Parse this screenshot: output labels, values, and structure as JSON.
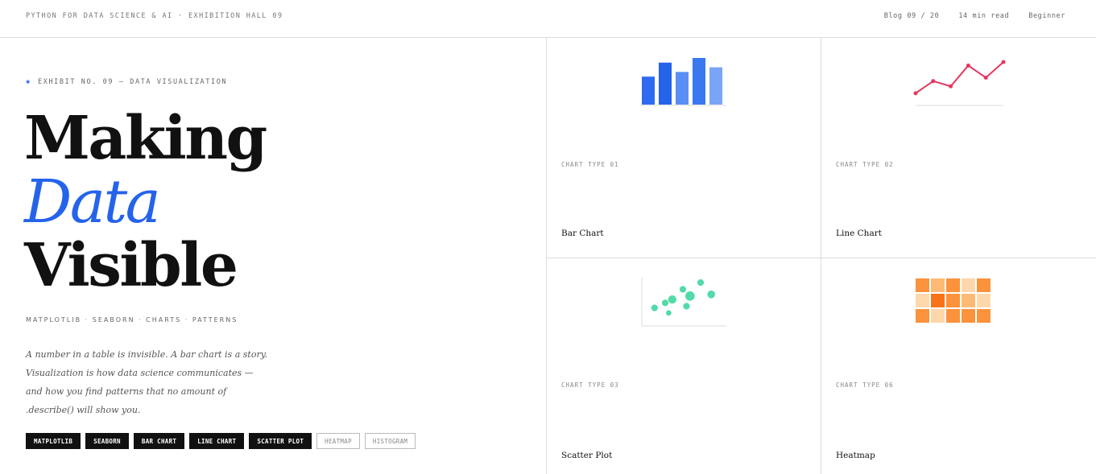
{
  "header": {
    "crumb": "PYTHON FOR DATA SCIENCE & AI · EXHIBITION HALL 09",
    "blog": "Blog 09 / 20",
    "read_time": "14 min read",
    "level": "Beginner"
  },
  "hero": {
    "eyebrow": "EXHIBIT NO. 09 — DATA VISUALIZATION",
    "line1": "Making",
    "line2": "Data",
    "line3": "Visible",
    "tagline": "MATPLOTLIB · SEABORN · CHARTS · PATTERNS",
    "lede": "A number in a table is invisible. A bar chart is a story. Visualization is how data science communicates — and how you find patterns that no amount of .describe() will show you.",
    "tags": [
      "MATPLOTLIB",
      "SEABORN",
      "BAR CHART",
      "LINE CHART",
      "SCATTER PLOT"
    ],
    "outline_tags": [
      "HEATMAP",
      "HISTOGRAM"
    ]
  },
  "cards": [
    {
      "num": "CHART TYPE 01",
      "title": "Bar Chart",
      "icon": "bar-chart-icon"
    },
    {
      "num": "CHART TYPE 02",
      "title": "Line Chart",
      "icon": "line-chart-icon"
    },
    {
      "num": "CHART TYPE 03",
      "title": "Scatter Plot",
      "icon": "scatter-plot-icon"
    },
    {
      "num": "CHART TYPE 06",
      "title": "Heatmap",
      "icon": "heatmap-icon"
    }
  ],
  "colors": {
    "accent": "#2563eb",
    "bar": [
      "#2f6bf0",
      "#2563eb",
      "#5b8ef5",
      "#3a78f2",
      "#7aa5f7"
    ],
    "line": "#e5375f",
    "scatter": "#34d399",
    "heat": [
      "#fdba74",
      "#fed7aa",
      "#fb923c",
      "#f97316",
      "#ffedd5"
    ]
  },
  "chart_data": [
    {
      "type": "bar",
      "values": [
        0.6,
        0.9,
        0.7,
        1.0,
        0.8
      ]
    },
    {
      "type": "line",
      "values": [
        0.05,
        0.4,
        0.25,
        0.85,
        0.5,
        0.95
      ]
    },
    {
      "type": "scatter",
      "points": [
        [
          0.1,
          0.2,
          0.3
        ],
        [
          0.25,
          0.35,
          0.3
        ],
        [
          0.3,
          0.05,
          0.2
        ],
        [
          0.35,
          0.45,
          0.45
        ],
        [
          0.5,
          0.75,
          0.3
        ],
        [
          0.55,
          0.25,
          0.3
        ],
        [
          0.6,
          0.55,
          0.55
        ],
        [
          0.75,
          0.95,
          0.3
        ],
        [
          0.9,
          0.6,
          0.4
        ]
      ]
    },
    {
      "type": "heatmap",
      "rows": 3,
      "cols": 5,
      "values": [
        [
          2,
          0,
          2,
          1,
          2
        ],
        [
          1,
          3,
          2,
          0,
          1
        ],
        [
          2,
          1,
          2,
          2,
          2
        ]
      ]
    }
  ]
}
